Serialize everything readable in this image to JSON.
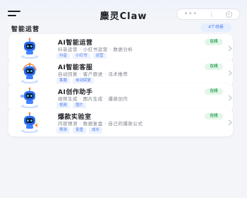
{
  "header": {
    "title": "麋灵Claw",
    "menu_icon": "menu-icon",
    "capsule_more_icon": "more-dots-icon",
    "capsule_close_icon": "miniprogram-close-icon"
  },
  "section": {
    "title": "智能运营",
    "count_badge": "4个场景"
  },
  "cards": [
    {
      "title": "AI智能运营",
      "description": "抖音运营 · 小红书运营 · 数据分析",
      "tags": [
        "抖音",
        "小红书",
        "运营"
      ],
      "status": "在线",
      "avatar_icon": "robot-icon"
    },
    {
      "title": "AI智能客服",
      "description": "自动回复 · 客户跟进 · 话术推荐",
      "tags": [
        "客服",
        "自动回复"
      ],
      "status": "在线",
      "avatar_icon": "robot-icon"
    },
    {
      "title": "AI创作助手",
      "description": "视频生成 · 图片生成 · 爆款创作",
      "tags": [
        "视频",
        "图片"
      ],
      "status": "在线",
      "avatar_icon": "robot-icon"
    },
    {
      "title": "爆款实验室",
      "description": "内容预测 · 数据复盘 · 自己的爆款公式",
      "tags": [
        "预测",
        "复盘",
        "成长"
      ],
      "status": "在线",
      "avatar_icon": "robot-icon"
    }
  ],
  "colors": {
    "accent": "#4c7bf0",
    "status_green": "#2fa35b",
    "background": "#f4f5f8"
  }
}
